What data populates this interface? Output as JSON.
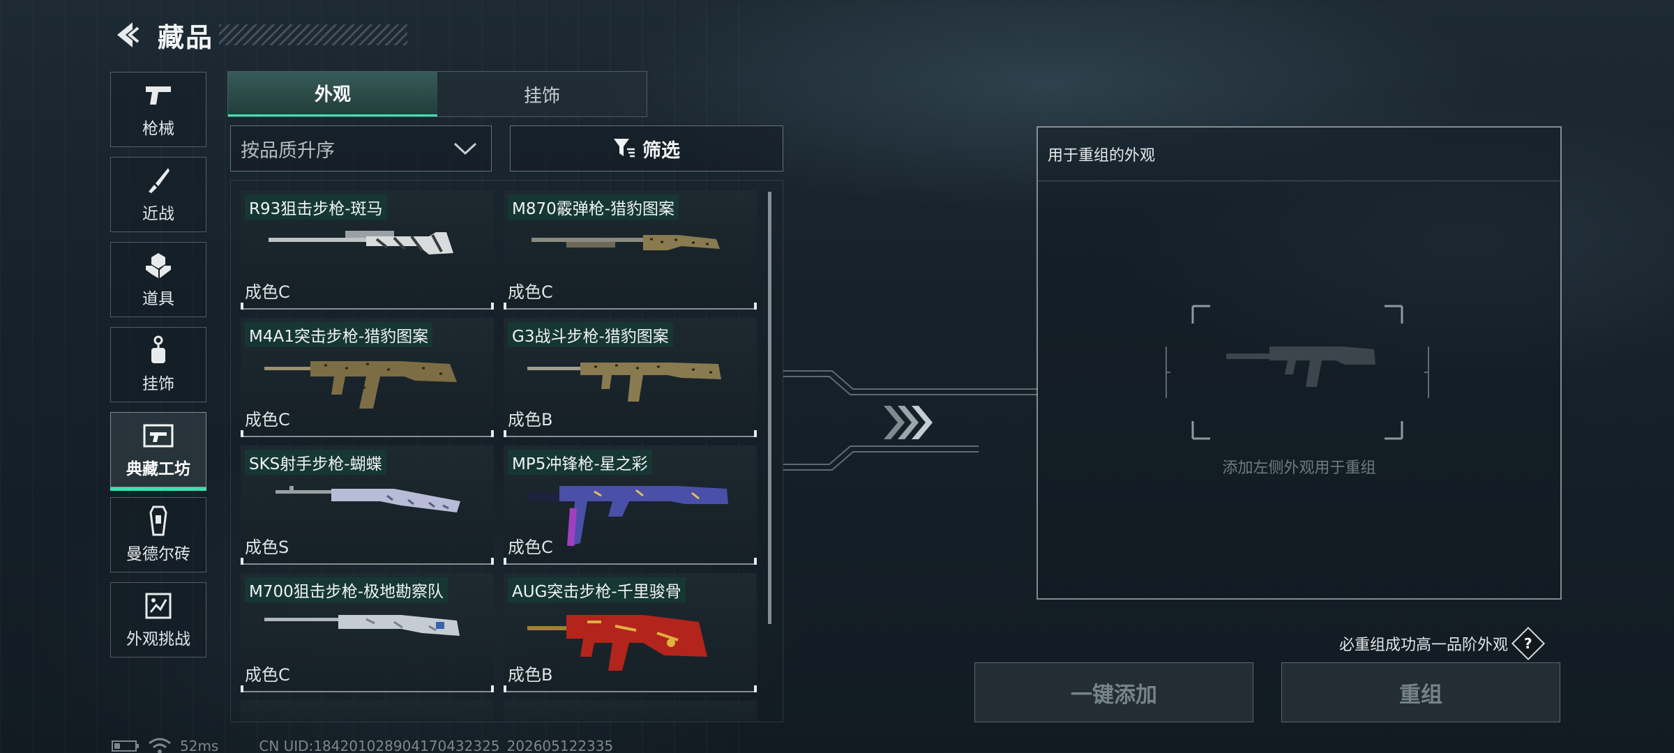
{
  "header": {
    "title": "藏品",
    "back_icon": "back-arrow-icon"
  },
  "side_nav": {
    "items": [
      {
        "label": "枪械",
        "icon": "pistol-icon"
      },
      {
        "label": "近战",
        "icon": "knife-icon"
      },
      {
        "label": "道具",
        "icon": "grenade-icon"
      },
      {
        "label": "挂饰",
        "icon": "charm-icon"
      },
      {
        "label": "典藏工坊",
        "icon": "workshop-icon",
        "active": true
      },
      {
        "label": "曼德尔砖",
        "icon": "brick-icon"
      },
      {
        "label": "外观挑战",
        "icon": "challenge-icon"
      }
    ]
  },
  "tabs": [
    {
      "label": "外观",
      "active": true
    },
    {
      "label": "挂饰",
      "active": false
    }
  ],
  "sort": {
    "value": "按品质升序",
    "icon": "chevron-down-icon"
  },
  "filter": {
    "label": "筛选",
    "icon": "funnel-icon"
  },
  "skins": [
    {
      "name": "R93狙击步枪-斑马",
      "grade": "成色C",
      "color": "#d9dcdd"
    },
    {
      "name": "M870霰弹枪-猎豹图案",
      "grade": "成色C",
      "color": "#8a7a50"
    },
    {
      "name": "M4A1突击步枪-猎豹图案",
      "grade": "成色C",
      "color": "#7d6d45"
    },
    {
      "name": "G3战斗步枪-猎豹图案",
      "grade": "成色B",
      "color": "#8a7a50"
    },
    {
      "name": "SKS射手步枪-蝴蝶",
      "grade": "成色S",
      "color": "#b8bcd6"
    },
    {
      "name": "MP5冲锋枪-星之彩",
      "grade": "成色C",
      "color": "#4a4fa8"
    },
    {
      "name": "M700狙击步枪-极地勘察队",
      "grade": "成色C",
      "color": "#c6ccd4"
    },
    {
      "name": "AUG突击步枪-千里骏骨",
      "grade": "成色B",
      "color": "#b3241c"
    }
  ],
  "panel": {
    "title": "用于重组的外观",
    "hint": "添加左侧外观用于重组"
  },
  "guarantee": {
    "text": "必重组成功高一品阶外观",
    "help": "?"
  },
  "buttons": {
    "add_all": "一键添加",
    "recombine": "重组"
  },
  "status": {
    "ping": "52ms",
    "uid": "CN UID:18420102890417043232​5_202605122335"
  },
  "colors": {
    "accent": "#3de0b0"
  }
}
